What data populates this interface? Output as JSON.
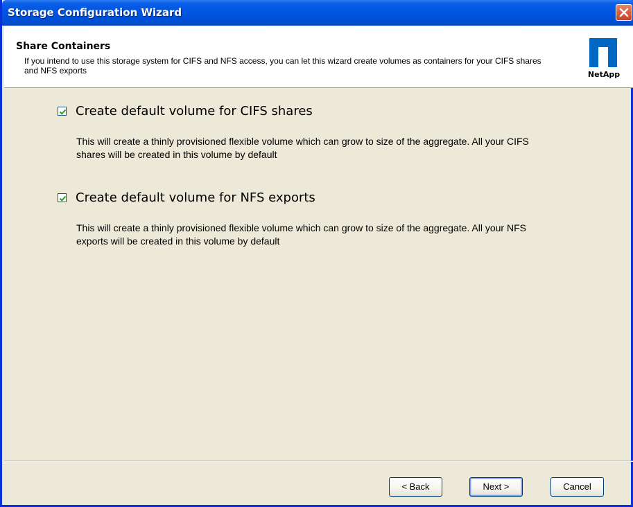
{
  "window": {
    "title": "Storage Configuration Wizard"
  },
  "header": {
    "title": "Share Containers",
    "description": "If you intend to use this storage system for CIFS and NFS access, you can let this wizard create volumes as containers for your CIFS shares and NFS exports",
    "logo_text": "NetApp"
  },
  "options": [
    {
      "label": "Create default volume for CIFS shares",
      "checked": true,
      "description": "This will create a thinly provisioned flexible volume which can grow to size of the aggregate. All your CIFS shares will be created in this volume by default"
    },
    {
      "label": "Create default volume for NFS exports",
      "checked": true,
      "description": "This will create a thinly provisioned flexible volume which can grow to size of the aggregate. All your NFS exports will be created in this volume by default"
    }
  ],
  "buttons": {
    "back": "< Back",
    "next": "Next >",
    "cancel": "Cancel"
  },
  "colors": {
    "titlebar": "#0054e3",
    "dialog_bg": "#ece9d8",
    "logo": "#0067c5",
    "check": "#21a121"
  }
}
